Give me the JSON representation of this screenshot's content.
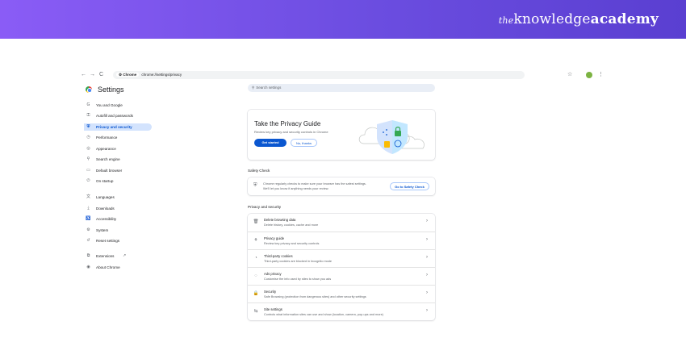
{
  "banner": {
    "brand_prefix": "the",
    "brand_mid": "knowledge",
    "brand_bold": "academy",
    "colors": {
      "start": "#8a5cf6",
      "end": "#5a3fd1"
    }
  },
  "browser": {
    "back_icon": "←",
    "forward_icon": "→",
    "reload_icon": "C",
    "site_chip": "Chrome",
    "url_path": "chrome://settings/privacy",
    "star_icon": "☆",
    "menu_icon": "⋮"
  },
  "settings": {
    "title": "Settings",
    "search_placeholder": "Search settings",
    "sidebar": [
      {
        "icon": "G",
        "label": "You and Google"
      },
      {
        "icon": "⚿",
        "label": "Autofill and passwords"
      },
      {
        "icon": "⛨",
        "label": "Privacy and security"
      },
      {
        "icon": "◷",
        "label": "Performance"
      },
      {
        "icon": "◎",
        "label": "Appearance"
      },
      {
        "icon": "⚲",
        "label": "Search engine"
      },
      {
        "icon": "▭",
        "label": "Default browser"
      },
      {
        "icon": "⏻",
        "label": "On startup"
      },
      {
        "icon": "文",
        "label": "Languages"
      },
      {
        "icon": "⤓",
        "label": "Downloads"
      },
      {
        "icon": "♿",
        "label": "Accessibility"
      },
      {
        "icon": "⚙",
        "label": "System"
      },
      {
        "icon": "↺",
        "label": "Reset settings"
      },
      {
        "icon": "⧉",
        "label": "Extensions"
      },
      {
        "icon": "◉",
        "label": "About Chrome"
      }
    ],
    "extensions_link_icon": "↗",
    "active_index": 2,
    "guide": {
      "title": "Take the Privacy Guide",
      "desc": "Review key privacy and security controls in Chrome",
      "primary": "Get started",
      "secondary": "No, thanks"
    },
    "safety_heading": "Safety Check",
    "safety": {
      "line1": "Chrome regularly checks to make sure your browser has the safest settings.",
      "line2": "We'll let you know if anything needs your review.",
      "button": "Go to Safety Check"
    },
    "privacy_heading": "Privacy and security",
    "rows": [
      {
        "icon": "🗑",
        "title": "Delete browsing data",
        "desc": "Delete history, cookies, cache and more"
      },
      {
        "icon": "⚘",
        "title": "Privacy guide",
        "desc": "Review key privacy and security controls"
      },
      {
        "icon": "◔",
        "title": "Third-party cookies",
        "desc": "Third-party cookies are blocked in Incognito mode"
      },
      {
        "icon": "◌",
        "title": "Ads privacy",
        "desc": "Customise the info used by sites to show you ads"
      },
      {
        "icon": "🔒",
        "title": "Security",
        "desc": "Safe Browsing (protection from dangerous sites) and other security settings"
      },
      {
        "icon": "⇆",
        "title": "Site settings",
        "desc": "Controls what information sites can use and show (location, camera, pop-ups and more)"
      }
    ],
    "chevron": "›"
  }
}
